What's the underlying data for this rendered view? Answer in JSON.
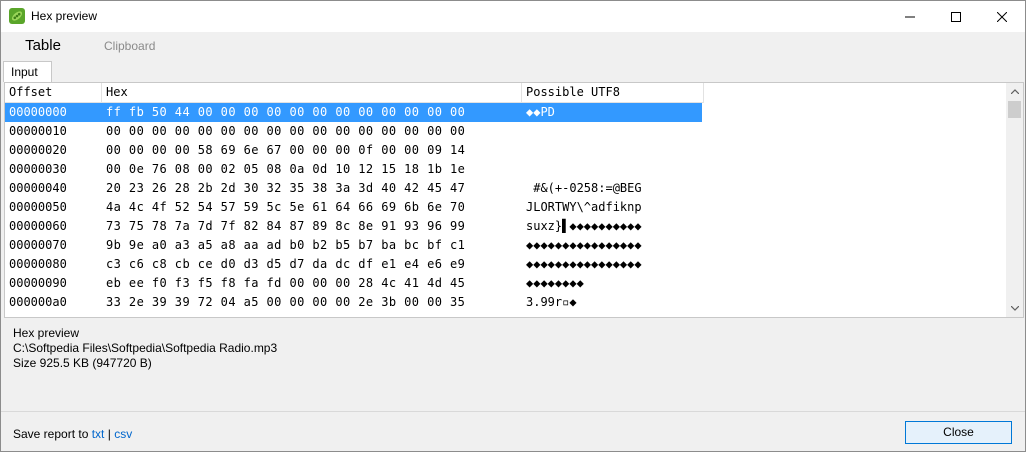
{
  "window": {
    "title": "Hex preview",
    "icon": "pea-pod-app-icon"
  },
  "menu": {
    "table": "Table",
    "clipboard": "Clipboard"
  },
  "tab": {
    "input": "Input"
  },
  "grid": {
    "headers": {
      "offset": "Offset",
      "hex": "Hex",
      "utf8": "Possible UTF8"
    },
    "rows": [
      {
        "offset": "00000000",
        "hex": "ff fb 50 44 00 00 00 00 00 00 00 00 00 00 00 00",
        "utf8": "◆◆PD",
        "selected": true
      },
      {
        "offset": "00000010",
        "hex": "00 00 00 00 00 00 00 00 00 00 00 00 00 00 00 00",
        "utf8": ""
      },
      {
        "offset": "00000020",
        "hex": "00 00 00 00 58 69 6e 67 00 00 00 0f 00 00 09 14",
        "utf8": ""
      },
      {
        "offset": "00000030",
        "hex": "00 0e 76 08 00 02 05 08 0a 0d 10 12 15 18 1b 1e",
        "utf8": ""
      },
      {
        "offset": "00000040",
        "hex": "20 23 26 28 2b 2d 30 32 35 38 3a 3d 40 42 45 47",
        "utf8": " #&(+-0258:=@BEG"
      },
      {
        "offset": "00000050",
        "hex": "4a 4c 4f 52 54 57 59 5c 5e 61 64 66 69 6b 6e 70",
        "utf8": "JLORTWY\\^adfiknp"
      },
      {
        "offset": "00000060",
        "hex": "73 75 78 7a 7d 7f 82 84 87 89 8c 8e 91 93 96 99",
        "utf8": "suxz}▌◆◆◆◆◆◆◆◆◆◆"
      },
      {
        "offset": "00000070",
        "hex": "9b 9e a0 a3 a5 a8 aa ad b0 b2 b5 b7 ba bc bf c1",
        "utf8": "◆◆◆◆◆◆◆◆◆◆◆◆◆◆◆◆"
      },
      {
        "offset": "00000080",
        "hex": "c3 c6 c8 cb ce d0 d3 d5 d7 da dc df e1 e4 e6 e9",
        "utf8": "◆◆◆◆◆◆◆◆◆◆◆◆◆◆◆◆"
      },
      {
        "offset": "00000090",
        "hex": "eb ee f0 f3 f5 f8 fa fd 00 00 00 28 4c 41 4d 45",
        "utf8": "◆◆◆◆◆◆◆◆"
      },
      {
        "offset": "000000a0",
        "hex": "33 2e 39 39 72 04 a5 00 00 00 00 2e 3b 00 00 35",
        "utf8": "3.99r▫◆"
      }
    ]
  },
  "info": {
    "title": "Hex preview",
    "path": "C:\\Softpedia Files\\Softpedia\\Softpedia Radio.mp3",
    "size": "Size 925.5 KB (947720 B)"
  },
  "footer": {
    "save_prefix": "Save report to",
    "txt_link": "txt",
    "separator": "|",
    "csv_link": "csv",
    "close_label": "Close"
  },
  "colors": {
    "selection": "#3399ff",
    "accent": "#0078d7",
    "link": "#0066cc"
  }
}
